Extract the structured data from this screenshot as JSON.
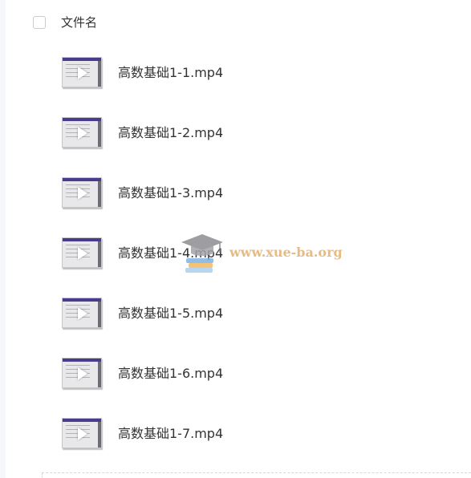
{
  "header": {
    "column_label": "文件名"
  },
  "files": [
    {
      "name": "高数基础1-1.mp4",
      "icon": "video-thumbnail-icon"
    },
    {
      "name": "高数基础1-2.mp4",
      "icon": "video-thumbnail-icon"
    },
    {
      "name": "高数基础1-3.mp4",
      "icon": "video-thumbnail-icon"
    },
    {
      "name": "高数基础1-4.mp4",
      "icon": "video-thumbnail-icon"
    },
    {
      "name": "高数基础1-5.mp4",
      "icon": "video-thumbnail-icon"
    },
    {
      "name": "高数基础1-6.mp4",
      "icon": "video-thumbnail-icon"
    },
    {
      "name": "高数基础1-7.mp4",
      "icon": "video-thumbnail-icon"
    }
  ],
  "watermark": {
    "text": "www.xue-ba.org",
    "icon": "graduation-cap-icon"
  },
  "colors": {
    "text": "#333333",
    "thumb_bar": "#4a3c8c",
    "watermark": "#e2b070"
  }
}
